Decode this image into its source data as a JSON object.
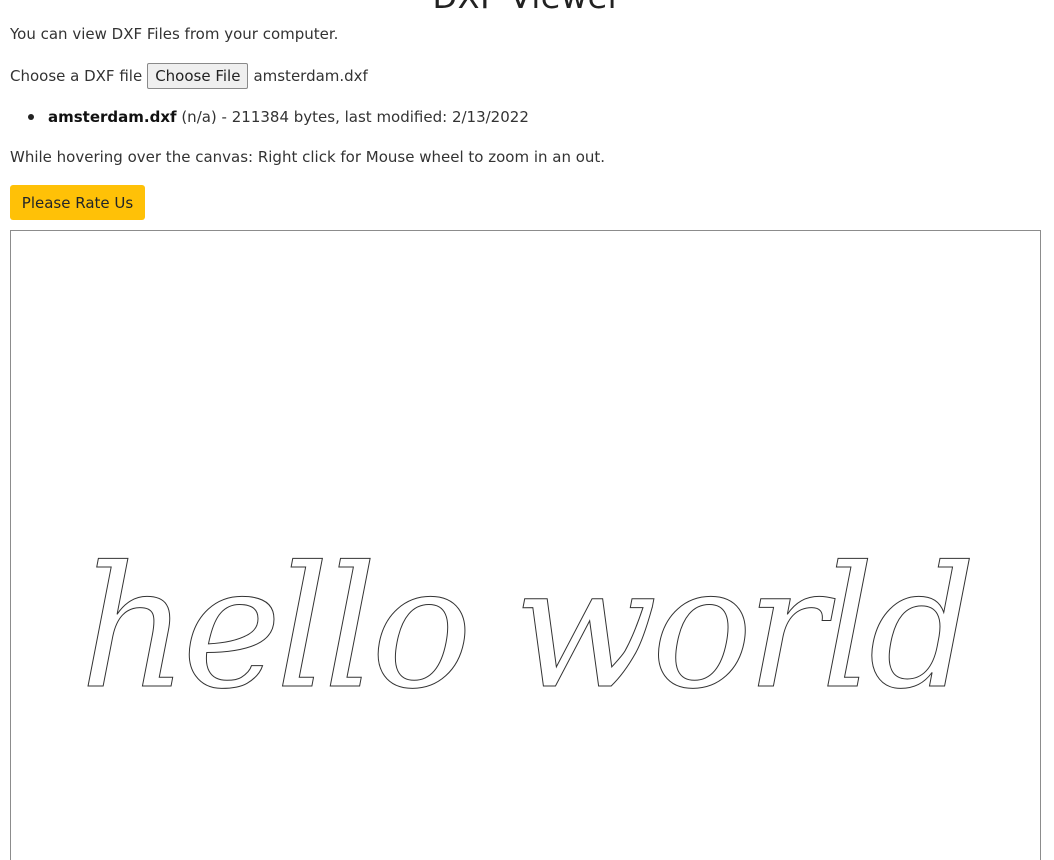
{
  "page": {
    "title": "DXF Viewer",
    "intro": "You can view DXF Files from your computer."
  },
  "file_input": {
    "label": "Choose a DXF file",
    "button_label": "Choose File",
    "selected_file": "amsterdam.dxf"
  },
  "file_list": [
    {
      "name": "amsterdam.dxf",
      "details": " (n/a) - 211384 bytes, last modified: 2/13/2022"
    }
  ],
  "hover_note": "While hovering over the canvas: Right click for Mouse wheel to zoom in an out.",
  "rate_button": {
    "label": "Please Rate Us",
    "color": "#ffc107"
  },
  "canvas": {
    "drawing_text": "hello world",
    "stroke_color": "#333333",
    "background": "#ffffff"
  }
}
